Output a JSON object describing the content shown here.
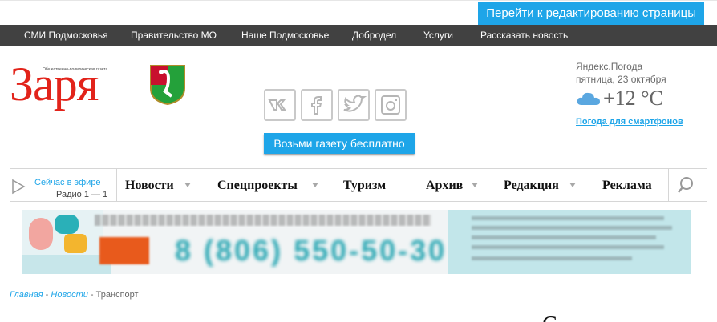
{
  "edit_bar": {
    "label": "Перейти к редактированию страницы"
  },
  "top_nav": {
    "items": [
      "СМИ Подмосковья",
      "Правительство МО",
      "Наше Подмосковье",
      "Добродел",
      "Услуги",
      "Рассказать новость"
    ]
  },
  "logo": {
    "title": "Заря",
    "small_text": "Общественно-политическая газета"
  },
  "social": [
    "vk-icon",
    "facebook-icon",
    "twitter-icon",
    "instagram-icon"
  ],
  "subscribe_button": "Возьми газету бесплатно",
  "weather": {
    "source": "Яндекс.Погода",
    "date": "пятница, 23 октября",
    "temp": "+12 °C",
    "link": "Погода для смартфонов"
  },
  "radio": {
    "live": "Сейчас в эфире",
    "station": "Радио 1 — 1"
  },
  "main_nav": {
    "items": [
      {
        "label": "Новости",
        "has_dropdown": true
      },
      {
        "label": "Спецпроекты",
        "has_dropdown": true
      },
      {
        "label": "Туризм",
        "has_dropdown": false
      },
      {
        "label": "Архив",
        "has_dropdown": true
      },
      {
        "label": "Редакция",
        "has_dropdown": true
      },
      {
        "label": "Реклама",
        "has_dropdown": false
      }
    ]
  },
  "banner": {
    "phone": "8 (806) 550-50-30"
  },
  "breadcrumb": {
    "home": "Главная",
    "news": "Новости",
    "sep": " - ",
    "current": "Транспорт"
  },
  "article_fragment": "С",
  "colors": {
    "accent": "#1ea5e8",
    "logo_red": "#e2231a",
    "nav_dark": "#414141"
  }
}
